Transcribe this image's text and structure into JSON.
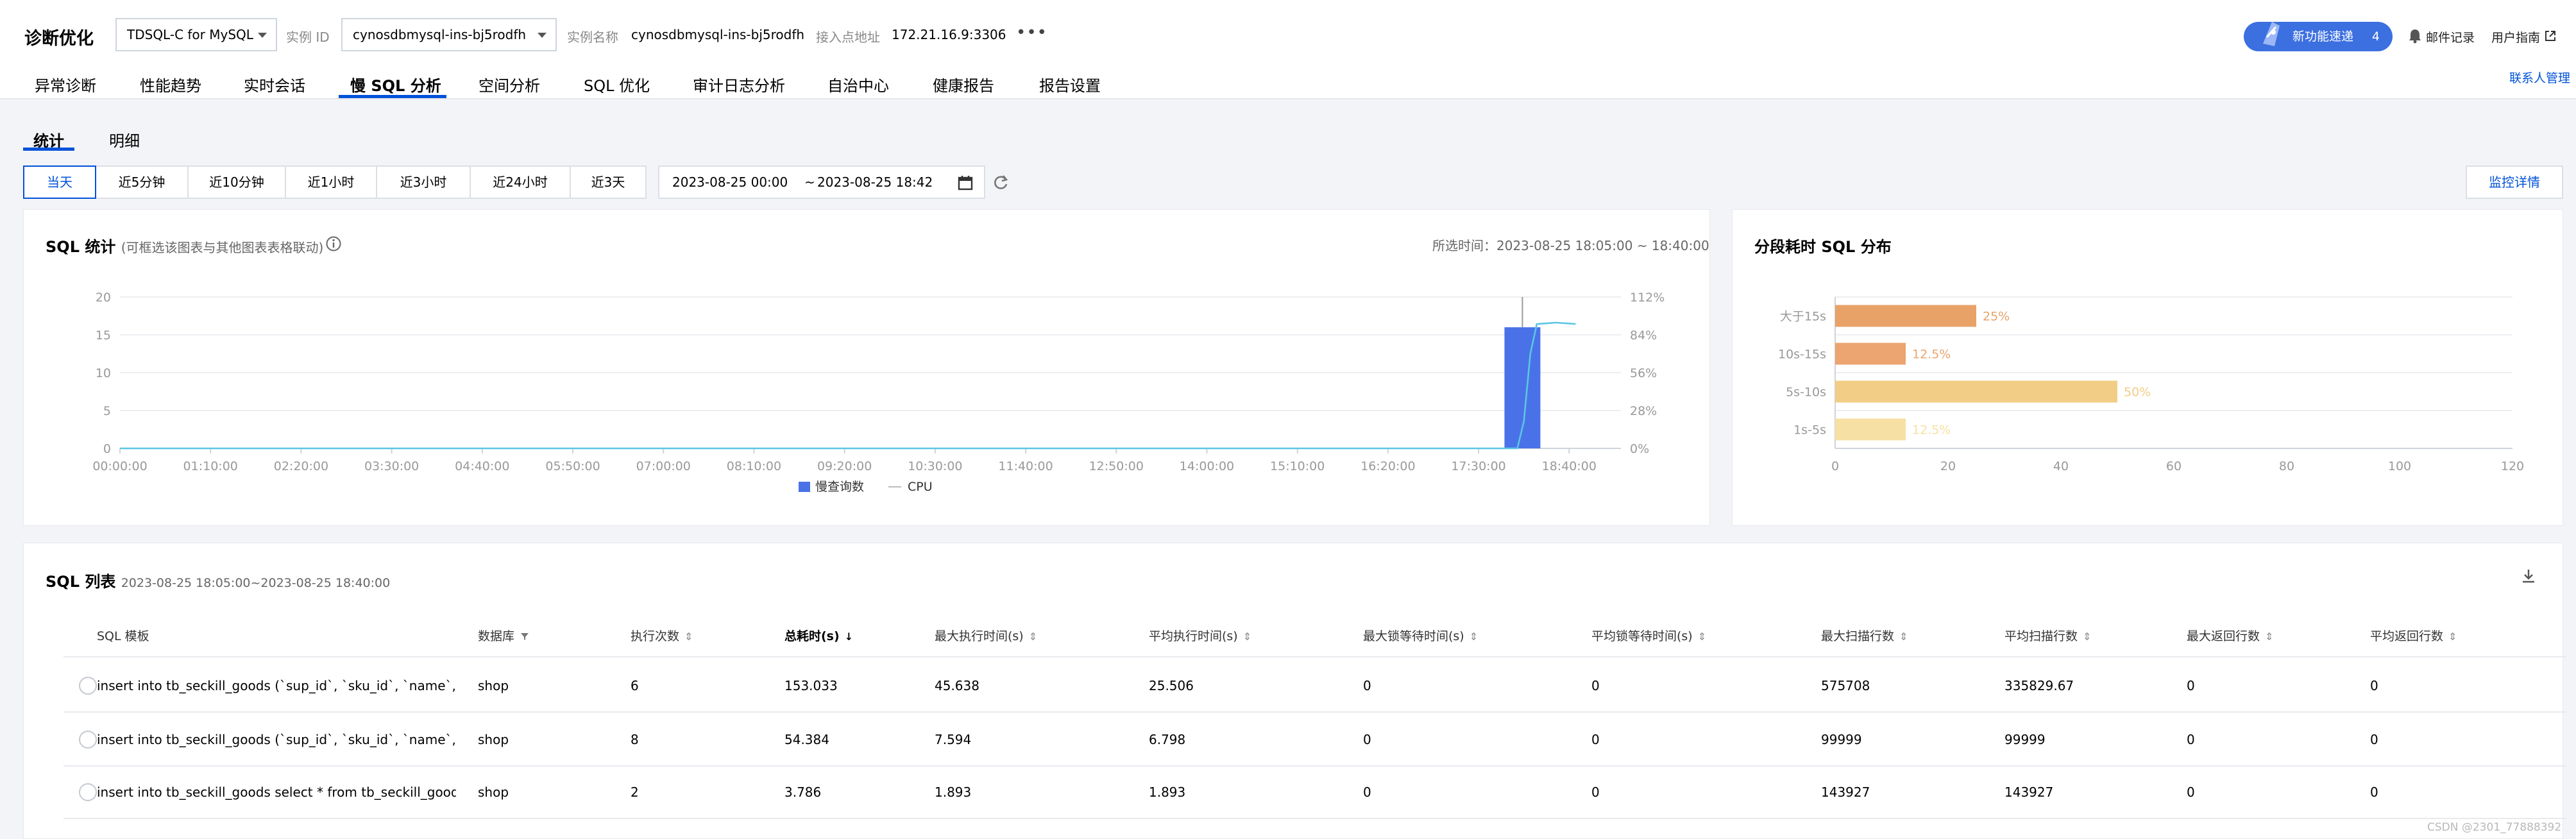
{
  "header": {
    "title": "诊断优化",
    "db_type": "TDSQL-C for MySQL",
    "instance_id_label": "实例 ID",
    "instance_id": "cynosdbmysql-ins-bj5rodfh",
    "instance_name_label": "实例名称",
    "instance_name": "cynosdbmysql-ins-bj5rodfh",
    "address_label": "接入点地址",
    "address": "172.21.16.9:3306",
    "more": "•••",
    "new_feature_label": "新功能速递",
    "new_feature_count": "4",
    "mail_label": "邮件记录",
    "guide_label": "用户指南",
    "contact_label": "联系人管理"
  },
  "tabs": [
    "异常诊断",
    "性能趋势",
    "实时会话",
    "慢 SQL 分析",
    "空间分析",
    "SQL 优化",
    "审计日志分析",
    "自治中心",
    "健康报告",
    "报告设置"
  ],
  "active_tab": "慢 SQL 分析",
  "subtabs": [
    "统计",
    "明细"
  ],
  "time_buttons": [
    "当天",
    "近5分钟",
    "近10分钟",
    "近1小时",
    "近3小时",
    "近24小时",
    "近3天"
  ],
  "active_time": "当天",
  "date_range": {
    "start": "2023-08-25 00:00",
    "sep": "~",
    "end": "2023-08-25 18:42"
  },
  "monitor_button": "监控详情",
  "sql_stats": {
    "title": "SQL 统计",
    "hint": "(可框选该图表与其他图表表格联动)",
    "selected_time_label": "所选时间：",
    "selected_time": "2023-08-25 18:05:00 ~ 18:40:00",
    "legend_slow": "慢查询数",
    "legend_cpu": "CPU"
  },
  "dist": {
    "title": "分段耗时 SQL 分布"
  },
  "chart_data": [
    {
      "type": "bar",
      "title": "SQL 统计",
      "x_ticks": [
        "00:00:00",
        "01:10:00",
        "02:20:00",
        "03:30:00",
        "04:40:00",
        "05:50:00",
        "07:00:00",
        "08:10:00",
        "09:20:00",
        "10:30:00",
        "11:40:00",
        "12:50:00",
        "14:00:00",
        "15:10:00",
        "16:20:00",
        "17:30:00",
        "18:40:00"
      ],
      "y_left_ticks": [
        "0",
        "5",
        "10",
        "15",
        "20"
      ],
      "y_right_ticks": [
        "0%",
        "28%",
        "56%",
        "84%",
        "112%"
      ],
      "ylim": [
        0,
        20
      ],
      "y2lim": [
        0,
        112
      ],
      "grid": true,
      "legend": "bottom",
      "series": [
        {
          "name": "慢查询数",
          "kind": "bar",
          "color": "#4a72e8",
          "points": [
            {
              "x": "17:50:00",
              "y": 16
            }
          ]
        },
        {
          "name": "CPU",
          "kind": "line",
          "color": "#5bc6e3",
          "points": [
            {
              "x": "00:00:00",
              "y": 0
            },
            {
              "x": "18:00:00",
              "y": 0
            },
            {
              "x": "18:05:00",
              "y": 20
            },
            {
              "x": "18:10:00",
              "y": 70
            },
            {
              "x": "18:15:00",
              "y": 92
            },
            {
              "x": "18:30:00",
              "y": 93
            },
            {
              "x": "18:45:00",
              "y": 92
            }
          ]
        }
      ]
    },
    {
      "type": "bar",
      "orientation": "horizontal",
      "title": "分段耗时 SQL 分布",
      "categories": [
        "大于15s",
        "10s-15s",
        "5s-10s",
        "1s-5s"
      ],
      "values": [
        25,
        12.5,
        50,
        12.5
      ],
      "labels": [
        "25%",
        "12.5%",
        "50%",
        "12.5%"
      ],
      "colors": [
        "#e8a268",
        "#eca470",
        "#f2cd86",
        "#f7e0a3"
      ],
      "x_ticks": [
        "0",
        "20",
        "40",
        "60",
        "80",
        "100",
        "120"
      ],
      "xlim": [
        0,
        120
      ],
      "grid": true
    }
  ],
  "sql_list": {
    "title": "SQL 列表",
    "range": "2023-08-25 18:05:00~2023-08-25 18:40:00",
    "columns": [
      "SQL 模板",
      "数据库",
      "执行次数",
      "总耗时(s)",
      "最大执行时间(s)",
      "平均执行时间(s)",
      "最大锁等待时间(s)",
      "平均锁等待时间(s)",
      "最大扫描行数",
      "平均扫描行数",
      "最大返回行数",
      "平均返回行数"
    ],
    "rows": [
      [
        "insert into tb_seckill_goods (`sup_id`, `sku_id`, `name`, `sma…",
        "shop",
        "6",
        "153.033",
        "45.638",
        "25.506",
        "0",
        "0",
        "575708",
        "335829.67",
        "0",
        "0"
      ],
      [
        "insert into tb_seckill_goods (`sup_id`, `sku_id`, `name`, `sma…",
        "shop",
        "8",
        "54.384",
        "7.594",
        "6.798",
        "0",
        "0",
        "99999",
        "99999",
        "0",
        "0"
      ],
      [
        "insert into tb_seckill_goods select * from tb_seckill_goods",
        "shop",
        "2",
        "3.786",
        "1.893",
        "1.893",
        "0",
        "0",
        "143927",
        "143927",
        "0",
        "0"
      ]
    ]
  },
  "watermark": "CSDN @2301_77888392"
}
